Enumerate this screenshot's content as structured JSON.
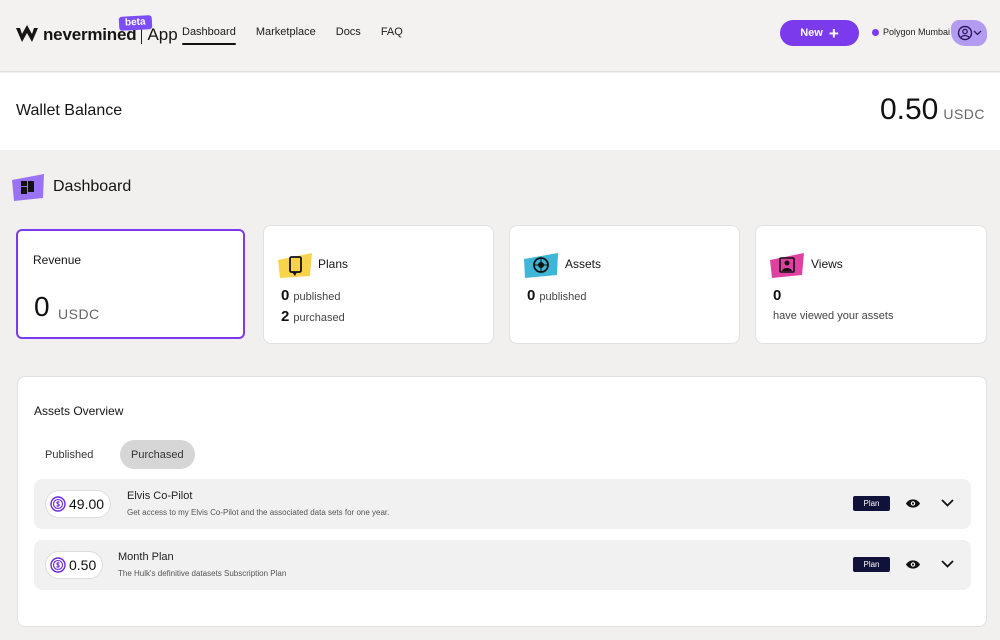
{
  "header": {
    "brand": "nevermined",
    "app_label": "App",
    "beta_label": "beta",
    "nav": [
      {
        "label": "Dashboard",
        "active": true
      },
      {
        "label": "Marketplace",
        "active": false
      },
      {
        "label": "Docs",
        "active": false
      },
      {
        "label": "FAQ",
        "active": false
      }
    ],
    "new_button": "New",
    "network": "Polygon Mumbai",
    "icons": {
      "logo": "nevermined-logo-icon",
      "plus": "plus-icon",
      "user": "user-icon",
      "chevron": "chevron-down-icon"
    }
  },
  "wallet": {
    "title": "Wallet Balance",
    "amount": "0.50",
    "unit": "USDC"
  },
  "dashboard": {
    "title": "Dashboard",
    "cards": {
      "revenue": {
        "title": "Revenue",
        "value": "0",
        "unit": "USDC"
      },
      "plans": {
        "title": "Plans",
        "published_count": "0",
        "published_label": "published",
        "purchased_count": "2",
        "purchased_label": "purchased"
      },
      "assets": {
        "title": "Assets",
        "published_count": "0",
        "published_label": "published"
      },
      "views": {
        "title": "Views",
        "count": "0",
        "label": "have viewed your assets"
      }
    }
  },
  "assets_overview": {
    "title": "Assets Overview",
    "tabs": [
      {
        "label": "Published",
        "active": false
      },
      {
        "label": "Purchased",
        "active": true
      }
    ],
    "rows": [
      {
        "price": "49.00",
        "title": "Elvis Co-Pilot",
        "description": "Get access to my Elvis Co-Pilot and the associated data sets for one year.",
        "badge": "Plan"
      },
      {
        "price": "0.50",
        "title": "Month Plan",
        "description": "The Hulk's definitive datasets Subscription Plan",
        "badge": "Plan"
      }
    ]
  },
  "colors": {
    "accent": "#7c3aed",
    "badge_bg": "#10123a",
    "plans_highlight": "#f7d44c",
    "assets_highlight": "#3fb6d6",
    "views_highlight": "#e040a0"
  }
}
